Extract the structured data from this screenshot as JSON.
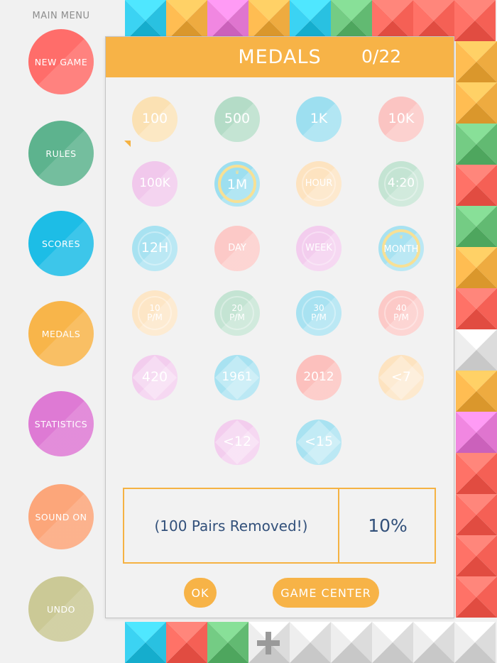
{
  "menu": {
    "title": "MAIN MENU",
    "buttons": [
      {
        "label": "NEW GAME",
        "color": "#ff6d6a"
      },
      {
        "label": "RULES",
        "color": "#5db38e"
      },
      {
        "label": "SCORES",
        "color": "#1dbde6"
      },
      {
        "label": "MEDALS",
        "color": "#f8b54a"
      },
      {
        "label": "STATISTICS",
        "color": "#de7ad4"
      },
      {
        "label": "SOUND ON",
        "color": "#fca67a"
      },
      {
        "label": "UNDO",
        "color": "#cbc996"
      }
    ]
  },
  "dialog": {
    "title": "MEDALS",
    "count": "0/22",
    "medals": [
      {
        "label": "100",
        "color": "#fbe1b3",
        "style": "plain"
      },
      {
        "label": "500",
        "color": "#b4dcc7",
        "style": "plain"
      },
      {
        "label": "1K",
        "color": "#9ddff0",
        "style": "plain"
      },
      {
        "label": "10K",
        "color": "#fbc4c2",
        "style": "plain"
      },
      {
        "label": "100K",
        "color": "#f1c8ec",
        "style": "plain"
      },
      {
        "label": "1M",
        "color": "#9ddff0",
        "style": "crown"
      },
      {
        "label": "HOUR",
        "color": "#fde3c0",
        "style": "inner"
      },
      {
        "label": "4:20",
        "color": "#c4e4d3",
        "style": "inner"
      },
      {
        "label": "12H",
        "color": "#a8e2f1",
        "style": "inner"
      },
      {
        "label": "DAY",
        "color": "#fcc9c7",
        "style": "plain"
      },
      {
        "label": "WEEK",
        "color": "#f3cdee",
        "style": "inner"
      },
      {
        "label": "MONTH",
        "color": "#a8e2f1",
        "style": "crown"
      },
      {
        "label": "10\nP/M",
        "color": "#fde6c6",
        "style": "inner"
      },
      {
        "label": "20\nP/M",
        "color": "#c4e4d3",
        "style": "inner"
      },
      {
        "label": "30\nP/M",
        "color": "#a8e2f1",
        "style": "inner"
      },
      {
        "label": "40\nP/M",
        "color": "#fcc9c7",
        "style": "inner"
      },
      {
        "label": "420",
        "color": "#f3cdee",
        "style": "diamond"
      },
      {
        "label": "1961",
        "color": "#a8e2f1",
        "style": "diamond"
      },
      {
        "label": "2012",
        "color": "#fcc0bd",
        "style": "plain"
      },
      {
        "label": "<7",
        "color": "#fde3c0",
        "style": "diamond"
      },
      {
        "label": "<12",
        "color": "#f3cdee",
        "style": "diamond"
      },
      {
        "label": "<15",
        "color": "#a8e2f1",
        "style": "diamond"
      }
    ],
    "info_text": "(100 Pairs Removed!)",
    "info_percent": "10%",
    "ok_label": "OK",
    "game_center_label": "GAME CENTER",
    "accent": "#f7b347"
  },
  "board": {
    "palette": {
      "cyan": "#33cbeb",
      "orange": "#f8b54a",
      "pink": "#e97fd9",
      "green": "#6cc47c",
      "red": "#ff6a5f",
      "empty": "#e6e6e6"
    },
    "top_row": [
      "cyan",
      "orange",
      "pink",
      "orange",
      "cyan",
      "green",
      "red",
      "red",
      "red"
    ],
    "right_column": [
      "orange",
      "orange",
      "green",
      "red",
      "green",
      "orange",
      "red",
      "empty",
      "orange",
      "pink",
      "red",
      "red",
      "red",
      "red"
    ],
    "bottom_row": [
      "cyan",
      "red",
      "green",
      "empty",
      "empty",
      "empty",
      "empty",
      "empty",
      "empty"
    ],
    "plus_icon": "plus-icon"
  }
}
